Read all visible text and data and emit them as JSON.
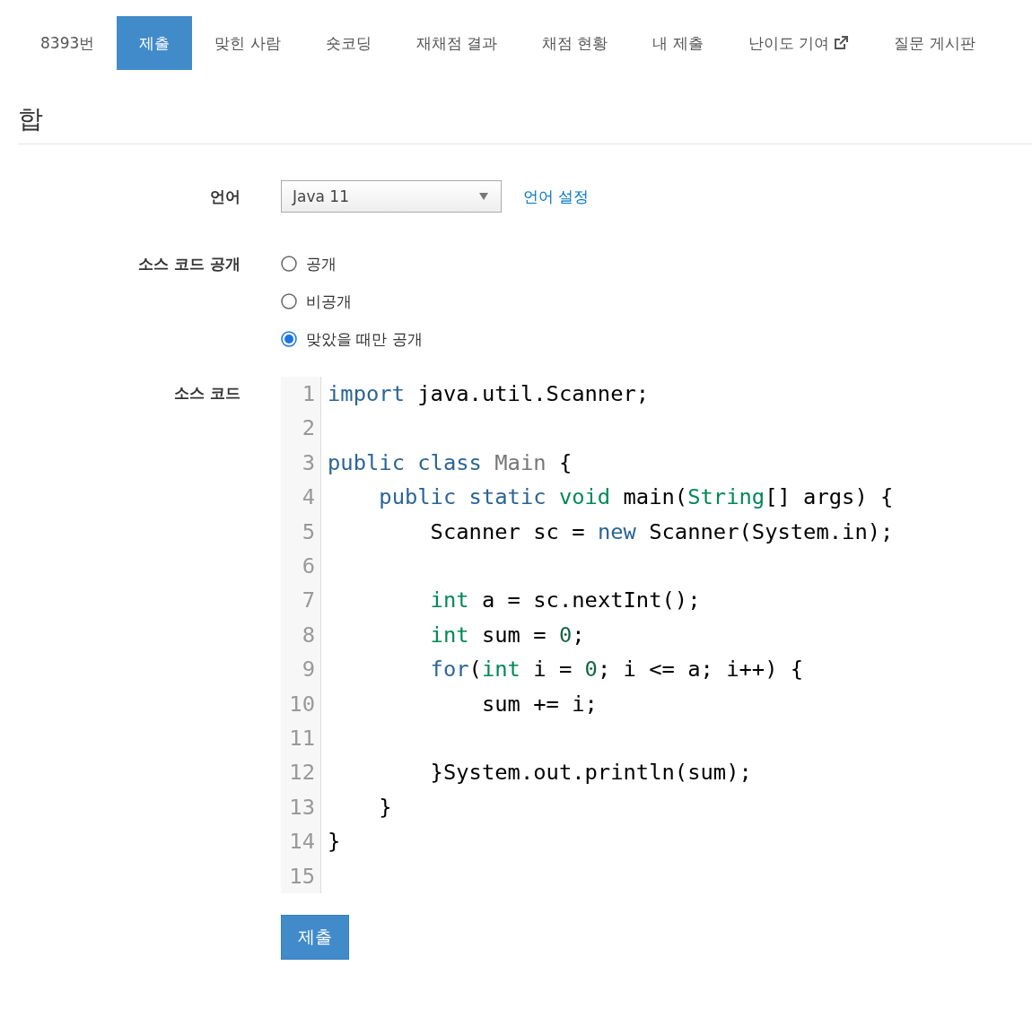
{
  "tabs": [
    {
      "label": "8393번",
      "selected": false,
      "external": false
    },
    {
      "label": "제출",
      "selected": true,
      "external": false
    },
    {
      "label": "맞힌 사람",
      "selected": false,
      "external": false
    },
    {
      "label": "숏코딩",
      "selected": false,
      "external": false
    },
    {
      "label": "재채점 결과",
      "selected": false,
      "external": false
    },
    {
      "label": "채점 현황",
      "selected": false,
      "external": false
    },
    {
      "label": "내 제출",
      "selected": false,
      "external": false
    },
    {
      "label": "난이도 기여",
      "selected": false,
      "external": true
    },
    {
      "label": "질문 게시판",
      "selected": false,
      "external": false
    }
  ],
  "title": "합",
  "language": {
    "label": "언어",
    "value": "Java 11",
    "link": "언어 설정"
  },
  "visibility": {
    "label": "소스 코드 공개",
    "options": [
      {
        "label": "공개",
        "selected": false
      },
      {
        "label": "비공개",
        "selected": false
      },
      {
        "label": "맞았을 때만 공개",
        "selected": true
      }
    ]
  },
  "source": {
    "label": "소스 코드",
    "lines": [
      {
        "number": "1",
        "tokens": [
          {
            "kind": "keyword",
            "text": "import"
          },
          {
            "kind": "plain",
            "text": " java.util.Scanner;"
          }
        ]
      },
      {
        "number": "2"
      },
      {
        "number": "3",
        "tokens": [
          {
            "kind": "keyword",
            "text": "public class"
          },
          {
            "kind": "def",
            "text": " Main"
          },
          {
            "kind": "plain",
            "text": " {"
          }
        ]
      },
      {
        "number": "4",
        "tokens": [
          {
            "kind": "keyword",
            "text": "    public static"
          },
          {
            "kind": "type",
            "text": " void"
          },
          {
            "kind": "plain",
            "text": " main("
          },
          {
            "kind": "type",
            "text": "String"
          },
          {
            "kind": "plain",
            "text": "[] args) {"
          }
        ]
      },
      {
        "number": "5",
        "tokens": [
          {
            "kind": "plain",
            "text": "        Scanner sc = "
          },
          {
            "kind": "keyword",
            "text": "new"
          },
          {
            "kind": "plain",
            "text": " Scanner(System.in);"
          }
        ]
      },
      {
        "number": "6"
      },
      {
        "number": "7",
        "tokens": [
          {
            "kind": "type",
            "text": "        int"
          },
          {
            "kind": "plain",
            "text": " a = sc.nextInt();"
          }
        ]
      },
      {
        "number": "8",
        "tokens": [
          {
            "kind": "type",
            "text": "        int"
          },
          {
            "kind": "plain",
            "text": " sum = "
          },
          {
            "kind": "number",
            "text": "0"
          },
          {
            "kind": "plain",
            "text": ";"
          }
        ]
      },
      {
        "number": "9",
        "tokens": [
          {
            "kind": "keyword",
            "text": "        for"
          },
          {
            "kind": "plain",
            "text": "("
          },
          {
            "kind": "type",
            "text": "int"
          },
          {
            "kind": "plain",
            "text": " i = "
          },
          {
            "kind": "number",
            "text": "0"
          },
          {
            "kind": "plain",
            "text": "; i <= a; i++) {"
          }
        ]
      },
      {
        "number": "10",
        "tokens": [
          {
            "kind": "plain",
            "text": "            sum += i;"
          }
        ]
      },
      {
        "number": "11"
      },
      {
        "number": "12",
        "tokens": [
          {
            "kind": "plain",
            "text": "        }System.out.println(sum);"
          }
        ]
      },
      {
        "number": "13",
        "tokens": [
          {
            "kind": "plain",
            "text": "    }"
          }
        ]
      },
      {
        "number": "14",
        "tokens": [
          {
            "kind": "plain",
            "text": "}"
          }
        ]
      },
      {
        "number": "15"
      }
    ]
  },
  "submit": "제출"
}
